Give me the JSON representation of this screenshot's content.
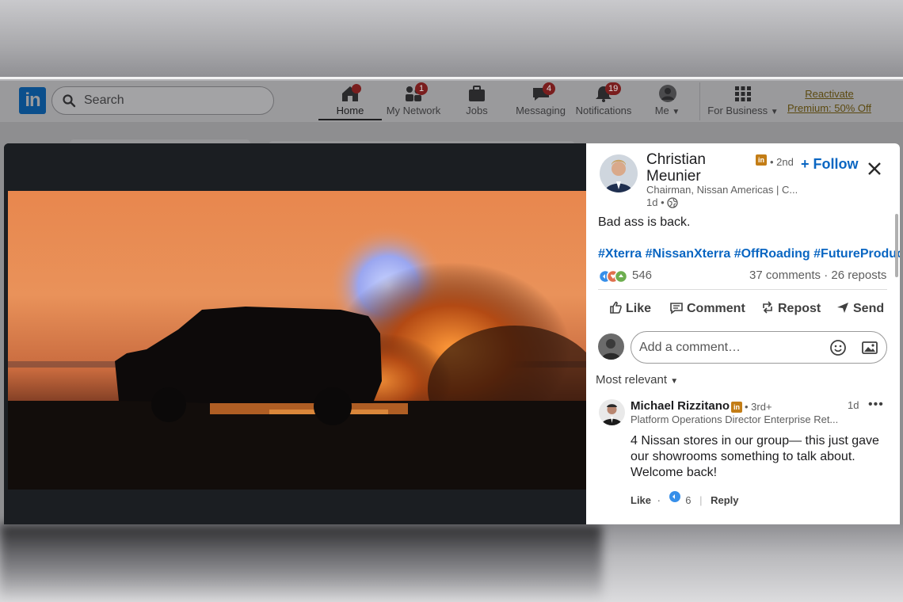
{
  "nav": {
    "search_placeholder": "Search",
    "items": [
      {
        "label": "Home",
        "badge": ""
      },
      {
        "label": "My Network",
        "badge": "1"
      },
      {
        "label": "Jobs",
        "badge": ""
      },
      {
        "label": "Messaging",
        "badge": "4"
      },
      {
        "label": "Notifications",
        "badge": "19"
      },
      {
        "label": "Me",
        "badge": ""
      },
      {
        "label": "For Business",
        "badge": ""
      }
    ],
    "premium_line1": "Reactivate",
    "premium_line2": "Premium: 50% Off"
  },
  "post": {
    "author_name": "Christian Meunier",
    "degree": "• 2nd",
    "follow_label": "+ Follow",
    "headline": "Chairman, Nissan Americas | C...",
    "time": "1d •",
    "text": "Bad ass is back.",
    "hashtags": [
      "#Xterra",
      "#NissanXterra",
      "#OffRoading",
      "#FutureProduct"
    ],
    "reactions_count": "546",
    "comments_reposts": "37 comments · 26 reposts",
    "actions": {
      "like": "Like",
      "comment": "Comment",
      "repost": "Repost",
      "send": "Send"
    },
    "comment_placeholder": "Add a comment…",
    "sort_label": "Most relevant"
  },
  "comment": {
    "author_name": "Michael Rizzitano",
    "degree": "• 3rd+",
    "headline": "Platform Operations Director Enterprise Ret...",
    "time": "1d",
    "more": "•••",
    "text": "4 Nissan stores in our group— this just gave our showrooms something to talk about. Welcome back!",
    "like_label": "Like",
    "dot": "·",
    "like_count": "6",
    "reply_label": "Reply"
  },
  "colors": {
    "accent": "#0a66c2",
    "premium_badge": "#c37d16"
  }
}
